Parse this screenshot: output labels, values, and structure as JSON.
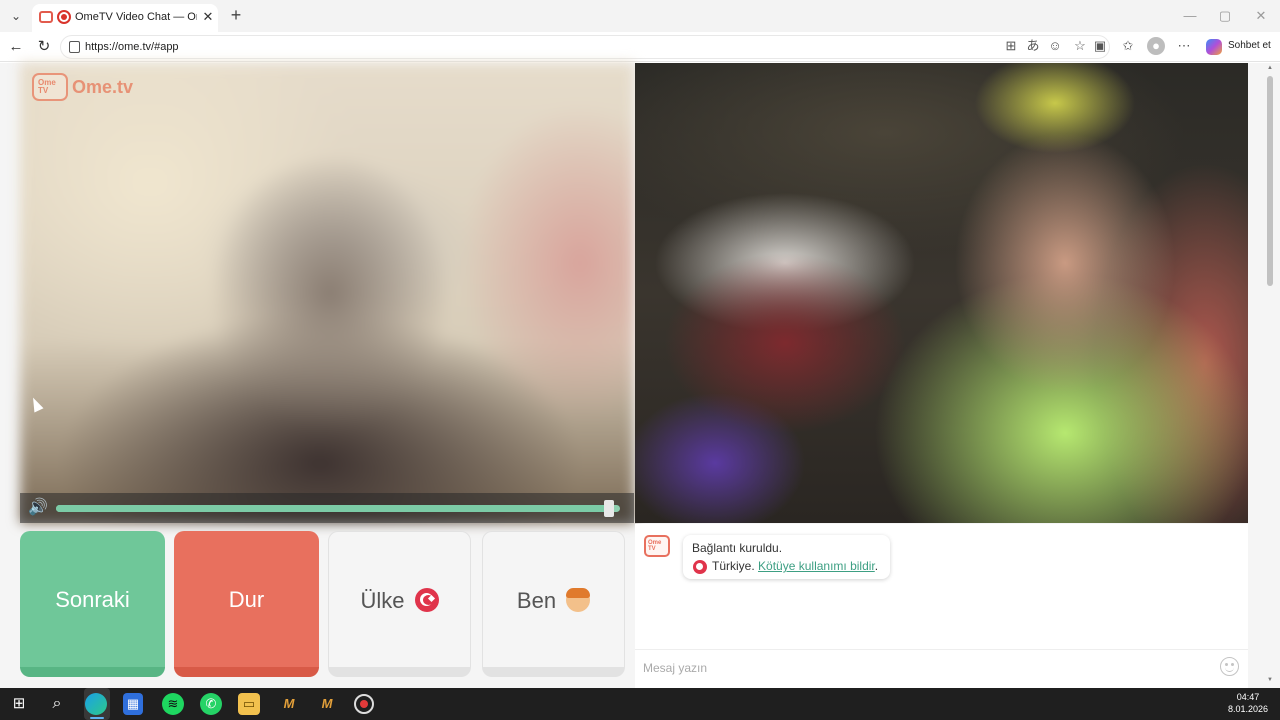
{
  "browser": {
    "tab_title": "OmeTV Video Chat — Omegle",
    "tab_close": "✕",
    "new_tab": "+",
    "url": "https://ome.tv/#app",
    "copilot_label": "Sohbet et",
    "window_controls": {
      "minimize": "—",
      "maximize": "▢",
      "close": "✕"
    },
    "icons": [
      "back-icon",
      "refresh-icon",
      "site-info-icon",
      "split-screen-icon",
      "translate-icon",
      "sidebar-icon",
      "favorite-icon",
      "media-icon",
      "favorites-bar-icon",
      "profile-icon",
      "more-icon",
      "copilot-icon"
    ]
  },
  "app": {
    "logo_text": "Ome.tv",
    "logo_badge": "Ome TV",
    "volume_level": 0.99,
    "buttons": {
      "next": "Sonraki",
      "stop": "Dur",
      "country": "Ülke",
      "me": "Ben"
    },
    "chat": {
      "system_message": "Bağlantı kuruldu.",
      "country_text": "Türkiye.",
      "report_link": "Kötüye kullanımı bildir",
      "report_suffix": ".",
      "input_placeholder": "Mesaj yazın"
    }
  },
  "taskbar": {
    "time": "04:47",
    "date": "8.01.2026",
    "apps": [
      "windows-start-icon",
      "search-icon",
      "edge-icon",
      "store-icon",
      "spotify-icon",
      "whatsapp-icon",
      "file-explorer-icon",
      "app-mb-icon",
      "app-mb2-icon",
      "obs-record-icon"
    ]
  },
  "colors": {
    "next_button": "#6fc799",
    "stop_button": "#e8705e",
    "link": "#3d9f83",
    "flag_red": "#e0344b"
  }
}
